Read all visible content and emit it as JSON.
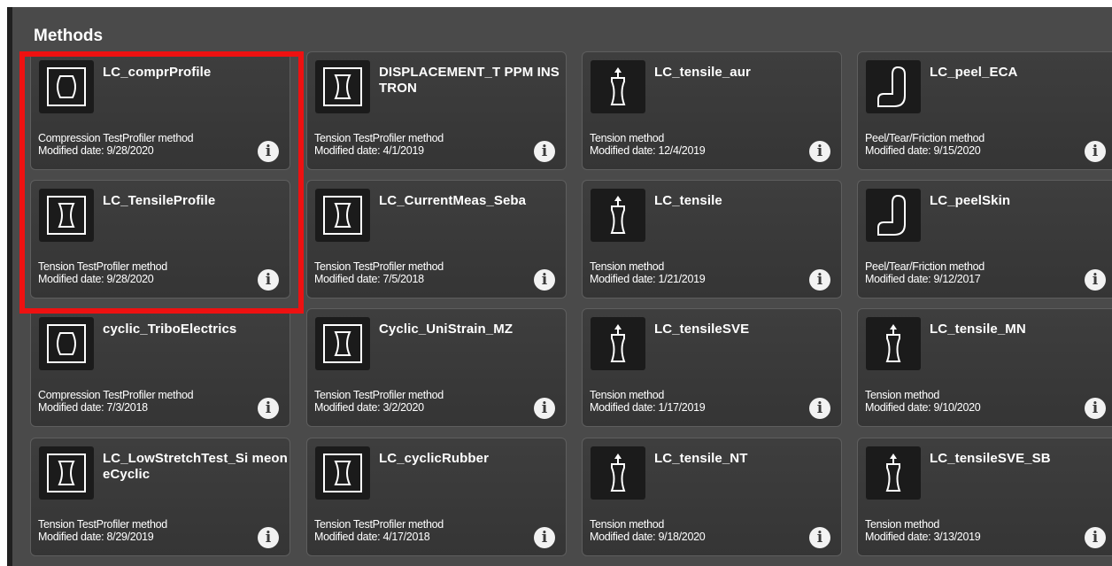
{
  "section": {
    "title": "Methods"
  },
  "colors": {
    "background": "#4a4a4a",
    "card": "#3a3a3a",
    "selection": "#ee1111",
    "text": "#ffffff"
  },
  "cards": [
    {
      "title": "LC_comprProfile",
      "type": "Compression TestProfiler method",
      "date": "Modified date: 9/28/2020",
      "icon": "compression-icon",
      "info": "i"
    },
    {
      "title": "DISPLACEMENT_T PPM INSTRON",
      "type": "Tension TestProfiler method",
      "date": "Modified date: 4/1/2019",
      "icon": "tension-icon",
      "info": "i"
    },
    {
      "title": "LC_tensile_aur",
      "type": "Tension method",
      "date": "Modified date: 12/4/2019",
      "icon": "tensile-arrow-icon",
      "info": "i"
    },
    {
      "title": "LC_peel_ECA",
      "type": "Peel/Tear/Friction method",
      "date": "Modified date: 9/15/2020",
      "icon": "peel-icon",
      "info": "i"
    },
    {
      "title": "LC_TensileProfile",
      "type": "Tension TestProfiler method",
      "date": "Modified date: 9/28/2020",
      "icon": "tension-icon",
      "info": "i"
    },
    {
      "title": "LC_CurrentMeas_Seba",
      "type": "Tension TestProfiler method",
      "date": "Modified date: 7/5/2018",
      "icon": "tension-icon",
      "info": "i"
    },
    {
      "title": "LC_tensile",
      "type": "Tension method",
      "date": "Modified date: 1/21/2019",
      "icon": "tensile-arrow-icon",
      "info": "i"
    },
    {
      "title": "LC_peelSkin",
      "type": "Peel/Tear/Friction method",
      "date": "Modified date: 9/12/2017",
      "icon": "peel-icon",
      "info": "i"
    },
    {
      "title": "cyclic_TriboElectrics",
      "type": "Compression TestProfiler method",
      "date": "Modified date: 7/3/2018",
      "icon": "compression-icon",
      "info": "i"
    },
    {
      "title": "Cyclic_UniStrain_MZ",
      "type": "Tension TestProfiler method",
      "date": "Modified date: 3/2/2020",
      "icon": "tension-icon",
      "info": "i"
    },
    {
      "title": "LC_tensileSVE",
      "type": "Tension method",
      "date": "Modified date: 1/17/2019",
      "icon": "tensile-arrow-icon",
      "info": "i"
    },
    {
      "title": "LC_tensile_MN",
      "type": "Tension method",
      "date": "Modified date: 9/10/2020",
      "icon": "tensile-arrow-icon",
      "info": "i"
    },
    {
      "title": "LC_LowStretchTest_Si meoneCyclic",
      "type": "Tension TestProfiler method",
      "date": "Modified date: 8/29/2019",
      "icon": "tension-icon",
      "info": "i"
    },
    {
      "title": "LC_cyclicRubber",
      "type": "Tension TestProfiler method",
      "date": "Modified date: 4/17/2018",
      "icon": "tension-icon",
      "info": "i"
    },
    {
      "title": "LC_tensile_NT",
      "type": "Tension method",
      "date": "Modified date: 9/18/2020",
      "icon": "tensile-arrow-icon",
      "info": "i"
    },
    {
      "title": "LC_tensileSVE_SB",
      "type": "Tension method",
      "date": "Modified date: 3/13/2019",
      "icon": "tensile-arrow-icon",
      "info": "i"
    }
  ]
}
